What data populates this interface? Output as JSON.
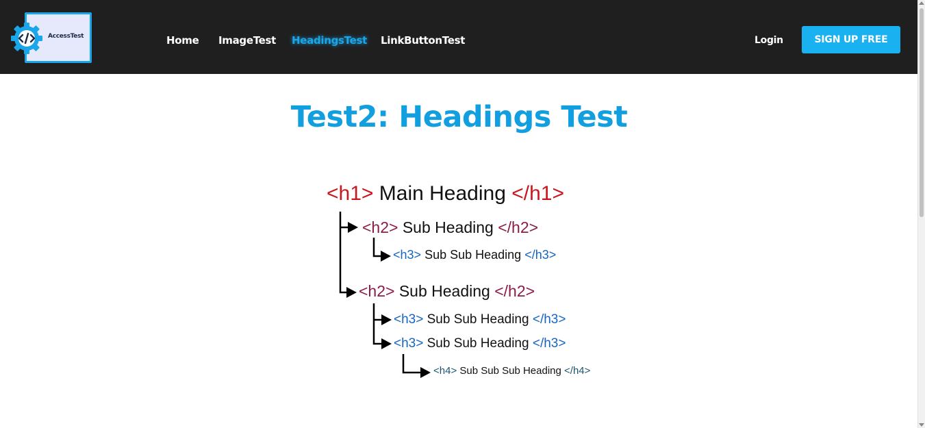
{
  "brand": {
    "name": "AccessTest",
    "logo_icon": "code-gear-icon"
  },
  "nav": {
    "links": [
      {
        "label": "Home"
      },
      {
        "label": "ImageTest"
      },
      {
        "label": "HeadingsTest"
      },
      {
        "label": "LinkButtonTest"
      }
    ],
    "login": "Login",
    "signup": "SIGN UP FREE"
  },
  "page": {
    "title": "Test2: Headings Test"
  },
  "headings": {
    "h1": {
      "open": "<h1>",
      "text": "Main Heading",
      "close": "</h1>"
    },
    "h2a": {
      "open": "<h2>",
      "text": "Sub Heading",
      "close": "</h2>"
    },
    "h3a": {
      "open": "<h3>",
      "text": "Sub Sub Heading",
      "close": "</h3>"
    },
    "h2b": {
      "open": "<h2>",
      "text": "Sub Heading",
      "close": "</h2>"
    },
    "h3b": {
      "open": "<h3>",
      "text": "Sub Sub Heading",
      "close": "</h3>"
    },
    "h3c": {
      "open": "<h3>",
      "text": "Sub Sub Heading",
      "close": "</h3>"
    },
    "h4": {
      "open": "<h4>",
      "text": "Sub Sub Sub Heading",
      "close": "</h4>"
    }
  },
  "colors": {
    "accent": "#1aa6e8",
    "title": "#119fdf",
    "navbar": "#1f1f1f",
    "h1_tag": "#c8171f",
    "h2_tag": "#8b1d4a",
    "h3_tag": "#1565c0",
    "h4_tag": "#1a5572"
  }
}
